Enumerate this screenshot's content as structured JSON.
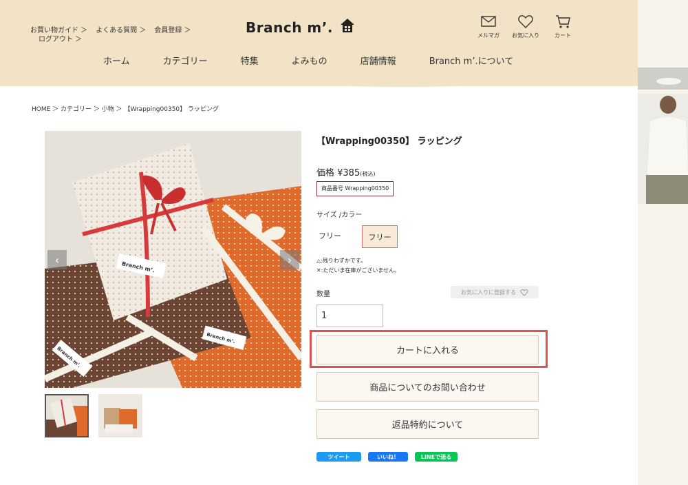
{
  "header": {
    "util_links": [
      "お買い物ガイド ＞",
      "よくある質問 ＞",
      "会員登録 ＞",
      "ログアウト ＞"
    ],
    "logo_text": "Branch m’.",
    "icons": [
      {
        "name": "mail-icon",
        "label": "メルマガ"
      },
      {
        "name": "heart-icon",
        "label": "お気に入り"
      },
      {
        "name": "cart-icon",
        "label": "カート"
      }
    ],
    "nav": [
      "ホーム",
      "カテゴリー",
      "特集",
      "よみもの",
      "店舗情報",
      "Branch m’.について"
    ]
  },
  "breadcrumb": "HOME ＞ カテゴリー ＞ 小物 ＞ 【Wrapping00350】 ラッピング",
  "product": {
    "title": "【Wrapping00350】 ラッピング",
    "price_label": "価格 ¥385",
    "price_tax": "(税込)",
    "sku": "商品番号 Wrapping00350",
    "size_label": "サイズ /カラー",
    "option_plain": "フリー",
    "option_selected": "フリー",
    "note1": "△:残りわずかです。",
    "note2": "✕:ただいま在庫がございません。",
    "qty_label": "数量",
    "qty_value": "1",
    "fav_label": "お気に入りに登録する",
    "add_to_cart": "カートに入れる",
    "inquiry": "商品についてのお問い合わせ",
    "return_policy": "返品特約について",
    "image_text": "Branch m’."
  },
  "share": {
    "tweet": "ツイート",
    "like": "いいね！",
    "line": "LINEで送る"
  },
  "colors": {
    "header_bg": "#f2e3c6",
    "highlight": "#d9534f",
    "ribbon": "#d63a3a",
    "orange": "#e06a2c"
  }
}
